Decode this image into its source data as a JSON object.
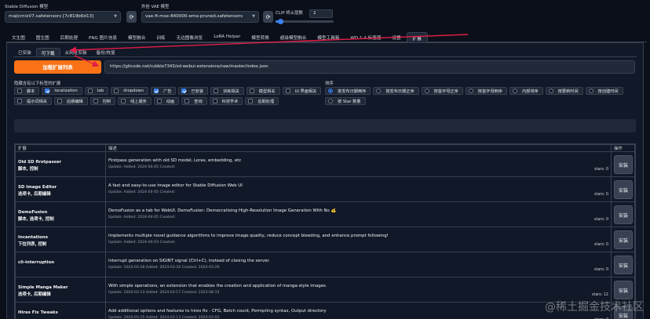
{
  "header": {
    "model_label": "Stable Diffusion 模型",
    "model_value": "majicmixV7.safetensors [7c819b6d13]",
    "vae_label": "外挂 VAE 模型",
    "vae_value": "vae-ft-mse-840000-ema-pruned.safetensors",
    "clip_label": "CLIP 终止层数",
    "clip_value": "2",
    "clip_fraction": 0.08,
    "refresh_glyph": "⟳"
  },
  "tabs": [
    "文生图",
    "图生图",
    "后期处理",
    "PNG 图片信息",
    "模型融合",
    "训练",
    "无边图像浏览",
    "LoRA Helper",
    "模型转换",
    "超级模型融合",
    "模型工具箱",
    "WD 1.4 标签器",
    "设置",
    "扩展"
  ],
  "active_tab": "扩展",
  "subtabs": [
    "已安装",
    "可下载",
    "从网址安装",
    "备份/恢复"
  ],
  "active_subtab": "可下载",
  "load_button": "加载扩展列表",
  "url_value": "https://gitcode.net/rubble7343/sd-webui-extensions/raw/master/index.json",
  "hide_label": "隐藏含有以下标签的扩展",
  "filters": [
    {
      "label": "脚本",
      "checked": false
    },
    {
      "label": "localization",
      "checked": true
    },
    {
      "label": "tab",
      "checked": false
    },
    {
      "label": "dropdown",
      "checked": false
    },
    {
      "label": "广告",
      "checked": true
    },
    {
      "label": "已安装",
      "checked": true
    },
    {
      "label": "训练相关",
      "checked": false
    },
    {
      "label": "模型相关",
      "checked": false
    },
    {
      "label": "UI 界面相关",
      "checked": false
    },
    {
      "label": "提示词相关",
      "checked": false
    },
    {
      "label": "后期编辑",
      "checked": false
    },
    {
      "label": "控制",
      "checked": false
    },
    {
      "label": "线上服务",
      "checked": false
    },
    {
      "label": "动画",
      "checked": false
    },
    {
      "label": "查询",
      "checked": false
    },
    {
      "label": "科技学术",
      "checked": false
    },
    {
      "label": "后期处理",
      "checked": false
    }
  ],
  "sort_label": "排序",
  "sort_options": [
    {
      "label": "按发布日期倒序",
      "selected": true
    },
    {
      "label": "按发布日期正序",
      "selected": false
    },
    {
      "label": "按首字母正序",
      "selected": false
    },
    {
      "label": "按首字母倒序",
      "selected": false
    },
    {
      "label": "内部排序",
      "selected": false
    },
    {
      "label": "按更新时间",
      "selected": false
    },
    {
      "label": "按创建时间",
      "selected": false
    },
    {
      "label": "按 Star 数量",
      "selected": false
    }
  ],
  "table": {
    "headers": [
      "扩展",
      "描述",
      "操作"
    ],
    "install_label": "安装",
    "rows": [
      {
        "name": "Old SD firstpasser",
        "tags": "脚本, 控制",
        "desc": "Firstpass generation with old SD model, Loras, embedding, etc",
        "meta": "Update: Added: 2024-04-05 Created:",
        "stars": "stars: 0"
      },
      {
        "name": "SD Image Editor",
        "tags": "选项卡, 后期编辑",
        "desc": "A fast and easy-to-use image editor for Stable Diffusion Web UI",
        "meta": "Update: Added: 2024-04-05 Created:",
        "stars": "stars: 0"
      },
      {
        "name": "DemoFusion",
        "tags": "脚本, 选项卡, 控制",
        "desc": "DemoFusion as a tab for WebUI. DemoFusion: Democratising High-Resolution Image Generation With No 💰",
        "meta": "Update: Added: 2024-04-05 Created:",
        "stars": "stars: 0"
      },
      {
        "name": "Incantations",
        "tags": "下拉列表, 控制",
        "desc": "Implements multiple novel guidance algorithms to improve image quality, reduce concept bleeding, and enhance prompt following!",
        "meta": "Update: Added: 2024-04-03 Created:",
        "stars": "stars: 0"
      },
      {
        "name": "cli-interruption",
        "tags": "",
        "desc": "Interrupt generation on SIGINT signal (Ctrl+C), instead of closing the server.",
        "meta": "Update: 2024-03-28 Added: 2024-03-26 Created: 2024-03-26",
        "stars": "stars: 0"
      },
      {
        "name": "Simple Manga Maker",
        "tags": "选项卡, 后期编辑",
        "desc": "With simple operations, an extension that enables the creation and application of manga-style images.",
        "meta": "Update: 2024-03-13 Added: 2024-03-17 Created: 2023-08-15",
        "stars": "stars: 12"
      },
      {
        "name": "Hires Fix Tweaks",
        "tags": "",
        "desc": "Add additional options and features to hires fix - CFG, Batch count, Pormpting syntax, Output directory",
        "meta": "Update: 2024-03-15 Added: 2024-03-13 Created: 2024-03-02",
        "stars": "stars: 0"
      }
    ]
  },
  "watermark": "@稀土掘金技术社区",
  "arrow_color": "#e11d48",
  "accent_color": "#f97316"
}
